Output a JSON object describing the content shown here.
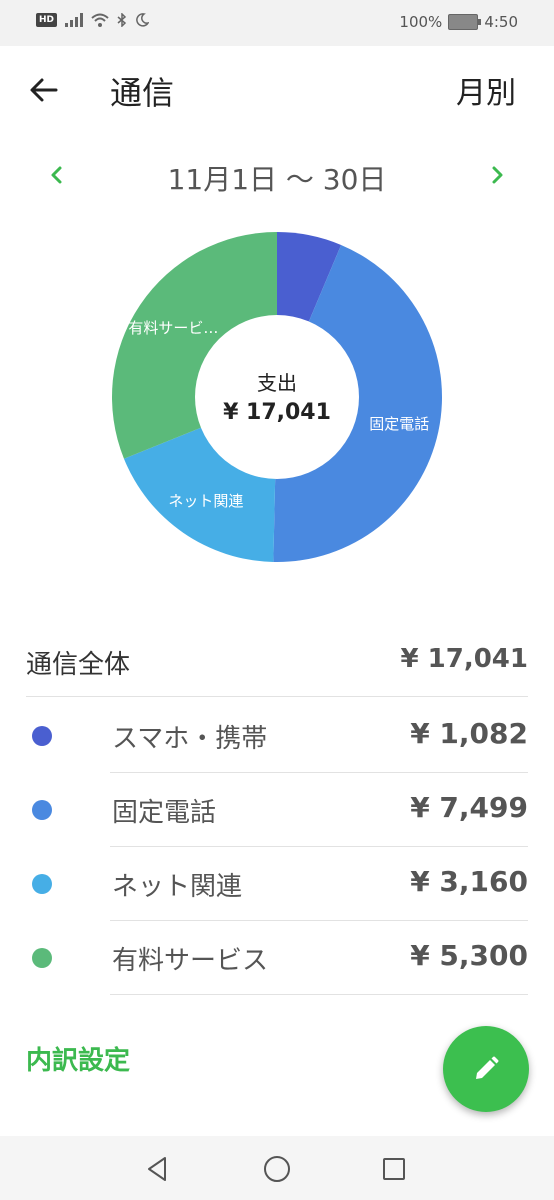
{
  "status_bar": {
    "hd": "HD",
    "battery_text": "100%",
    "time": "4:50"
  },
  "header": {
    "title": "通信",
    "monthly_label": "月別"
  },
  "date_nav": {
    "range": "11月1日 〜 30日"
  },
  "colors": {
    "accent": "#3cb94f",
    "smartphone": "#4a5fd0",
    "landline": "#4a89e0",
    "internet": "#46aee6",
    "paid_services": "#5bba7a"
  },
  "chart_data": {
    "type": "pie",
    "center_label": "支出",
    "center_value": "¥ 17,041",
    "slices": [
      {
        "name": "スマホ・携帯",
        "value": 1082,
        "label": ""
      },
      {
        "name": "固定電話",
        "value": 7499,
        "label": "固定電話"
      },
      {
        "name": "ネット関連",
        "value": 3160,
        "label": "ネット関連"
      },
      {
        "name": "有料サービス",
        "value": 5300,
        "label": "有料サービ…"
      }
    ]
  },
  "summary": {
    "label": "通信全体",
    "amount": "¥ 17,041"
  },
  "categories": [
    {
      "label": "スマホ・携帯",
      "amount": "¥ 1,082"
    },
    {
      "label": "固定電話",
      "amount": "¥ 7,499"
    },
    {
      "label": "ネット関連",
      "amount": "¥ 3,160"
    },
    {
      "label": "有料サービス",
      "amount": "¥ 5,300"
    }
  ],
  "breakdown_link": "内訳設定",
  "icons": {
    "back": "arrow-left-icon",
    "prev": "chevron-left-icon",
    "next": "chevron-right-icon",
    "fab": "pencil-icon",
    "nav_back": "triangle-back-icon",
    "nav_home": "circle-home-icon",
    "nav_recent": "square-recent-icon"
  }
}
